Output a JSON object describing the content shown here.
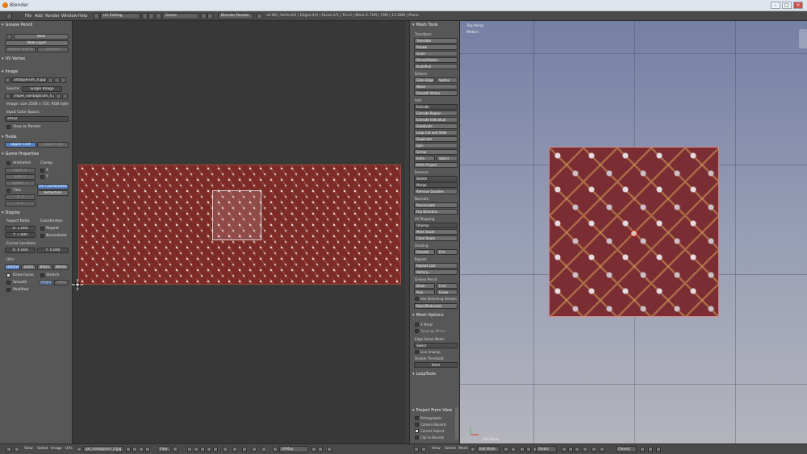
{
  "window": {
    "title": "Blender"
  },
  "menu": {
    "items": [
      "File",
      "Add",
      "Render",
      "Window",
      "Help"
    ],
    "layout": "UV Editing",
    "scene": "Scene",
    "engine": "Blender Render",
    "stats": "v2.66 | Verts:4/4 | Edges:4/4 | Faces:1/1 | Tris:2 | Mem:2.71M | 76M | 12.56M | Plane"
  },
  "left_panel": {
    "grease_pencil": {
      "header": "Grease Pencil",
      "new": "New",
      "new_layer": "New Layer",
      "delete_frame": "Delete Frame",
      "convert": "Convert"
    },
    "uv_vertex": {
      "header": "UV Vertex"
    },
    "image": {
      "header": "Image",
      "image_name": "antiquerum_4.jpg",
      "source_label": "Source:",
      "source_value": "Single Image",
      "filepath": "//Spel_vardagsrum_4.jpg",
      "info": "Image: size 2506 x 750, RGB byte",
      "color_space_label": "Input Color Space:",
      "color_space": "sRGB",
      "view_as_render": "View as Render"
    },
    "fields": {
      "header": "Fields",
      "upper_first": "Upper First",
      "lower_first": "Lower First"
    },
    "game_properties": {
      "header": "Game Properties",
      "animated": "Animated",
      "clamp": "Clamp:",
      "x": "X",
      "y": "Y",
      "start": "Start: 0",
      "end": "End: 0",
      "speed": "Speed: 5",
      "tiles": "Tiles",
      "tx": "X: 1",
      "ty": "Y: 1",
      "uv_coordinates": "UV Coordinates",
      "reflection": "Reflection"
    },
    "display": {
      "header": "Display",
      "aspect_ratio": "Aspect Ratio:",
      "coordinates": "Coordinates:",
      "ax": "X: 1.000",
      "ay": "Y: 1.000",
      "repeat": "Repeat",
      "normalized": "Normalized",
      "cursor_location": "Cursor Location:",
      "cx": "X: 0.000",
      "cy": "Y: 0.000",
      "uvs": "UVs:",
      "outline": "Outline",
      "dash": "Dash",
      "black": "Black",
      "white": "White",
      "draw_faces": "Draw Faces",
      "stretch": "Stretch",
      "smooth": "Smooth",
      "angle": "Angle",
      "area": "Area",
      "modified": "Modified"
    }
  },
  "toolshelf": {
    "header": "Mesh Tools",
    "transform": "Transform:",
    "translate": "Translate",
    "rotate": "Rotate",
    "scale": "Scale",
    "shrink_fatten": "Shrink/Fatten",
    "push_pull": "Push/Pull",
    "deform": "Deform:",
    "slide_edge": "Slide Edge",
    "vertex": "Vertex",
    "noise": "Noise",
    "smooth_vertex": "Smooth Vertex",
    "add": "Add:",
    "extrude": "Extrude",
    "extrude_region": "Extrude Region",
    "extrude_individual": "Extrude Individual",
    "subdivide": "Subdivide",
    "loop_cut": "Loop Cut and Slide",
    "duplicate": "Duplicate",
    "spin": "Spin",
    "screw": "Screw",
    "knife": "Knife",
    "select": "Select",
    "knife_project": "Knife Project",
    "remove": "Remove:",
    "delete": "Delete",
    "merge": "Merge",
    "remove_doubles": "Remove Doubles",
    "normals": "Normals:",
    "recalculate": "Recalculate",
    "flip_direction": "Flip Direction",
    "uv_mapping": "UV Mapping:",
    "unwrap": "Unwrap",
    "mark_seam": "Mark Seam",
    "clear_seam": "Clear Seam",
    "shading": "Shading:",
    "smooth": "Smooth",
    "flat": "Flat",
    "repeat": "Repeat:",
    "repeat_last": "Repeat Last",
    "history": "History...",
    "grease_pencil": "Grease Pencil:",
    "draw": "Draw",
    "line": "Line",
    "poly": "Poly",
    "erase": "Erase",
    "use_sketching": "Use Sketching Session",
    "ruler": "Ruler/Protractor",
    "mesh_options": "Mesh Options",
    "x_mirror": "X Mirror",
    "topology_mirror": "Topology Mirror",
    "edge_select_mode": "Edge Select Mode:",
    "select_mode": "Select",
    "live_unwrap": "Live Unwrap",
    "double_threshold": "Double Threshold:",
    "threshold": "0mm",
    "looptools": "LoopTools",
    "project_from_view": "Project From View",
    "orthographic": "Orthographic",
    "camera_bounds": "Camera Bounds",
    "correct_aspect": "Correct Aspect",
    "clip_to_bounds": "Clip to Bounds"
  },
  "viewport": {
    "view_name": "Top Persp",
    "units": "Meters",
    "object_info": "(24) Plane"
  },
  "uv_header": {
    "view": "View",
    "select": "Select",
    "image": "Image",
    "uvs": "UVs",
    "image_name": "pel_vardagsrum_4.jpg",
    "view_label": "View",
    "uvmap": "UVMap"
  },
  "view3d_header": {
    "view": "View",
    "select": "Select",
    "mesh": "Mesh",
    "mode": "Edit Mode",
    "pivot": "Global",
    "proportional": "Closest"
  }
}
